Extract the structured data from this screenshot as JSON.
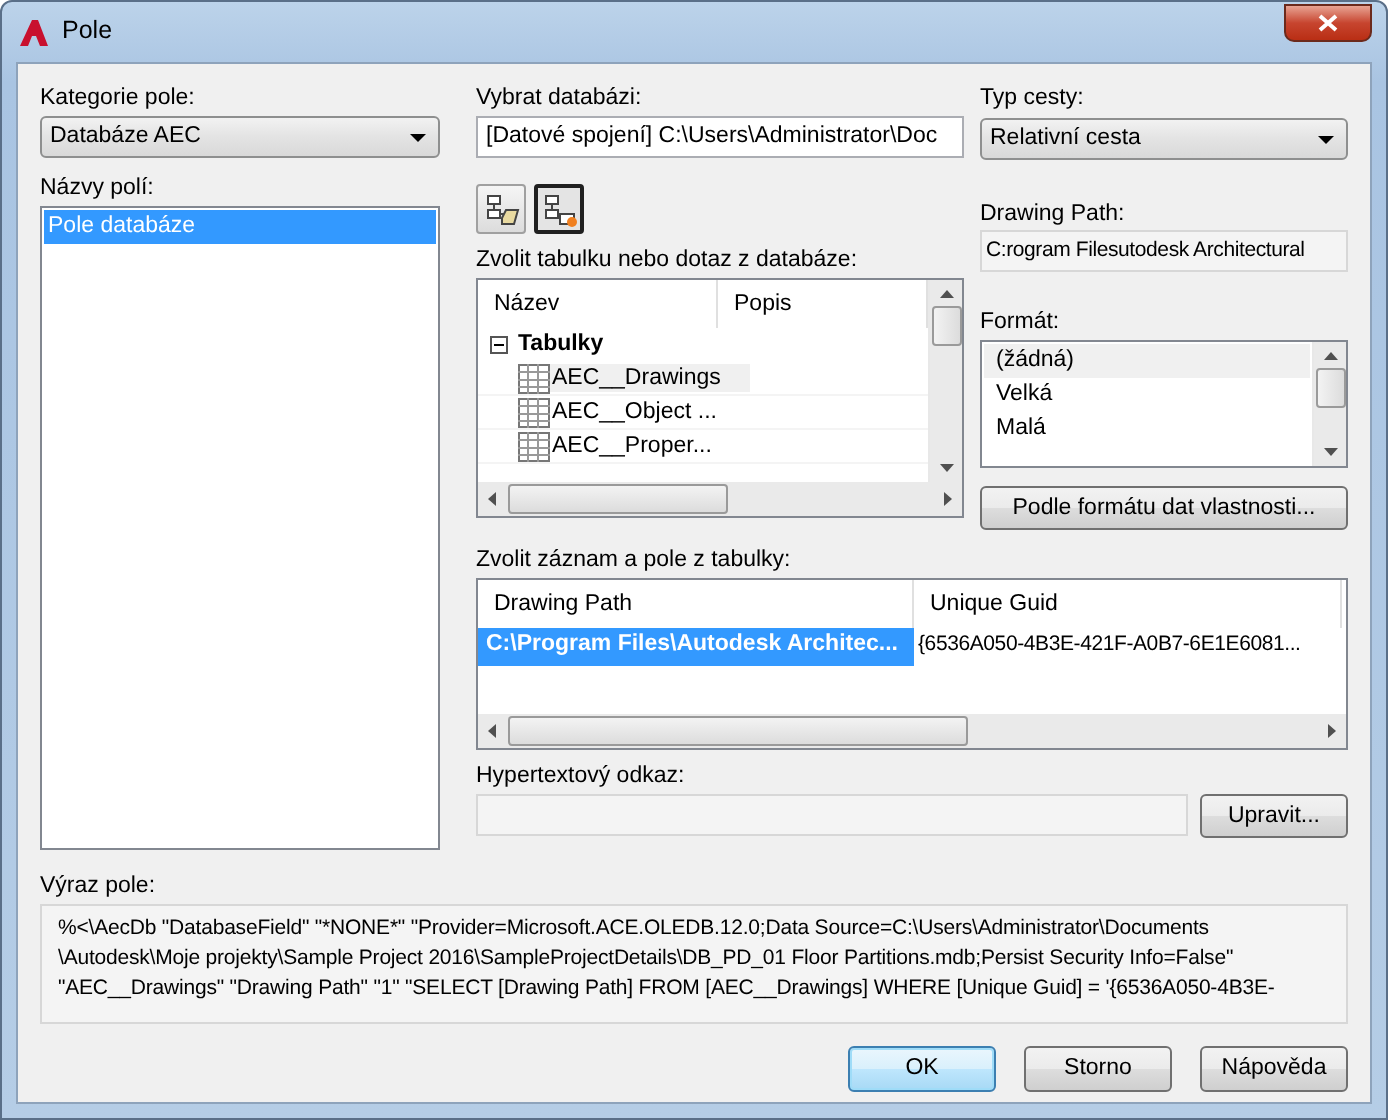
{
  "window": {
    "title": "Pole"
  },
  "field_category": {
    "label": "Kategorie pole:",
    "value": "Databáze AEC"
  },
  "field_names": {
    "label": "Názvy polí:",
    "items": [
      {
        "text": "Pole databáze",
        "selected": true
      }
    ]
  },
  "database": {
    "label": "Vybrat databázi:",
    "value": "[Datové spojení] C:\\Users\\Administrator\\Doc"
  },
  "toolbar": [
    {
      "kind": "open",
      "pressed": false
    },
    {
      "kind": "new",
      "pressed": true
    }
  ],
  "table_picker": {
    "label": "Zvolit tabulku nebo dotaz z databáze:",
    "columns": [
      "Název",
      "Popis"
    ],
    "tree": [
      {
        "text": "Tabulky",
        "expanded": true,
        "children": [
          {
            "text": "AEC__Drawings",
            "selected": true
          },
          {
            "text": "AEC__Object ...",
            "selected": false
          },
          {
            "text": "AEC__Proper...",
            "selected": false
          }
        ]
      }
    ]
  },
  "path_type": {
    "label": "Typ cesty:",
    "value": "Relativní cesta"
  },
  "drawing_path": {
    "label": "Drawing Path:",
    "value": "C:rogram Filesutodesk Architectural"
  },
  "format": {
    "label": "Formát:",
    "items": [
      {
        "text": "(žádná)",
        "selected": true
      },
      {
        "text": "Velká",
        "selected": false
      },
      {
        "text": "Malá",
        "selected": false
      }
    ],
    "button": "Podle formátu dat vlastnosti..."
  },
  "records": {
    "label": "Zvolit záznam a pole z tabulky:",
    "columns": [
      "Drawing Path",
      "Unique Guid"
    ],
    "rows": [
      {
        "cells": [
          "C:\\Program Files\\Autodesk Architec...",
          "{6536A050-4B3E-421F-A0B7-6E1E6081..."
        ],
        "selected": true
      }
    ]
  },
  "hyperlink": {
    "label": "Hypertextový odkaz:",
    "button": "Upravit..."
  },
  "expression": {
    "label": "Výraz pole:",
    "lines": [
      "%<\\AecDb \"DatabaseField\" \"*NONE*\" \"Provider=Microsoft.ACE.OLEDB.12.0;Data Source=C:\\Users\\Administrator\\Documents",
      "\\Autodesk\\Moje projekty\\Sample Project 2016\\SampleProjectDetails\\DB_PD_01 Floor Partitions.mdb;Persist Security Info=False\"",
      "\"AEC__Drawings\" \"Drawing Path\" \"1\" \"SELECT [Drawing Path] FROM [AEC__Drawings] WHERE [Unique Guid] = '{6536A050-4B3E-"
    ]
  },
  "buttons": [
    {
      "label": "OK",
      "default": true
    },
    {
      "label": "Storno",
      "default": false
    },
    {
      "label": "Nápověda",
      "default": false
    }
  ]
}
